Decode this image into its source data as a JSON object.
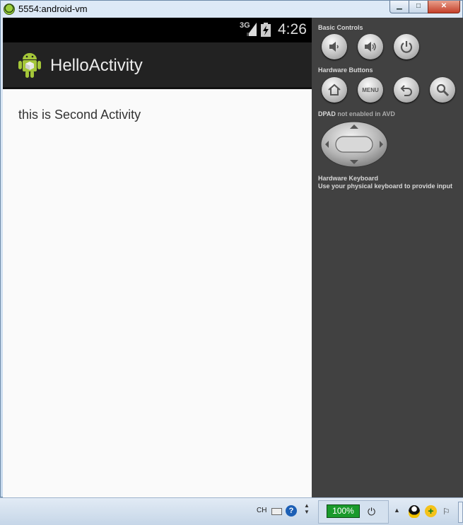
{
  "window": {
    "title": "5554:android-vm",
    "minimize_glyph": "▁",
    "maximize_glyph": "□",
    "close_glyph": "✕"
  },
  "statusbar": {
    "network": "3G",
    "time": "4:26"
  },
  "app": {
    "title": "HelloActivity",
    "content_text": "this is Second Activity"
  },
  "panel": {
    "basic_controls_heading": "Basic Controls",
    "hardware_buttons_heading": "Hardware Buttons",
    "menu_label": "MENU",
    "dpad_heading_bold": "DPAD",
    "dpad_heading_rest": " not enabled in AVD",
    "keyboard_heading": "Hardware Keyboard",
    "keyboard_note": "Use your physical keyboard to provide input"
  },
  "taskbar": {
    "ime": "CH",
    "help_glyph": "?",
    "battery_percent": "100%"
  },
  "colors": {
    "statusbar_bg": "#000000",
    "actionbar_bg": "#222222",
    "panel_bg": "#414141",
    "screen_bg": "#fafafa",
    "android_green": "#a4c639"
  }
}
